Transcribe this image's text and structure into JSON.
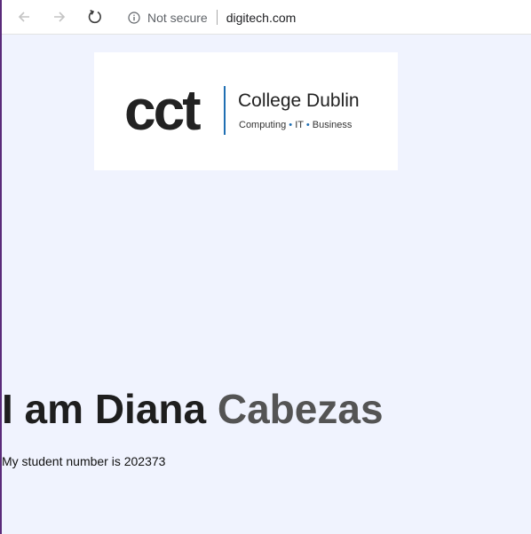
{
  "browser": {
    "security_label": "Not secure",
    "url": "digitech.com",
    "icons": {
      "back": "arrow-left-icon",
      "forward": "arrow-right-icon",
      "reload": "reload-icon",
      "info": "info-circle-icon"
    }
  },
  "logo": {
    "mark": "cct",
    "name": "College Dublin",
    "tagline_items": [
      "Computing",
      "IT",
      "Business"
    ],
    "accent_color": "#1f6fb3"
  },
  "main": {
    "heading_first": "I am Diana",
    "heading_last": "Cabezas",
    "student_text": "My student number is 202373"
  },
  "colors": {
    "page_background": "#f0f3fe",
    "heading_first": "#1e1e1e",
    "heading_last": "#545454"
  }
}
